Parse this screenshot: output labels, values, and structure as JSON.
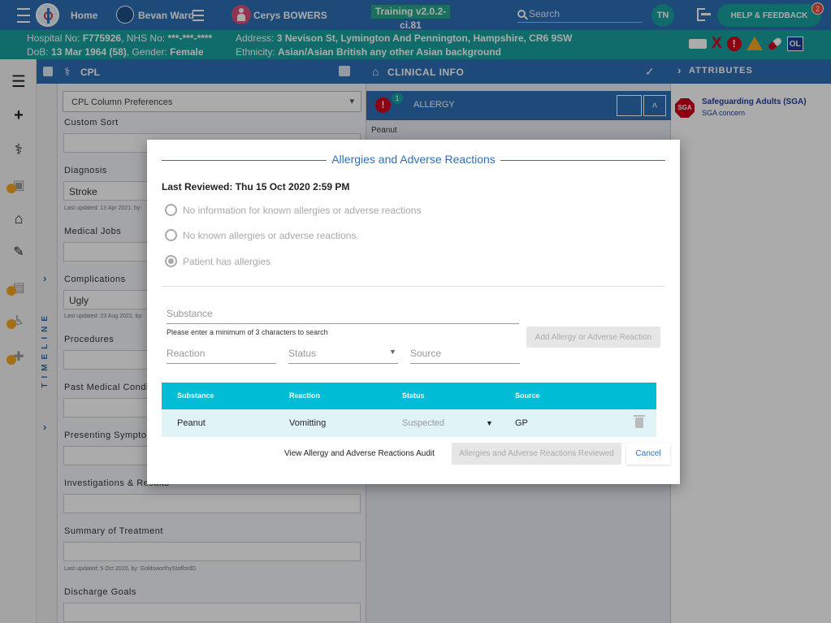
{
  "topbar": {
    "home_label": "Home",
    "ward_label": "Bevan Ward",
    "patient_name": "Cerys BOWERS",
    "training_label": "Training v2.0.2-ci.81",
    "search_placeholder": "Search",
    "user_initials": "TN",
    "help_label": "HELP & FEEDBACK",
    "notification_count": "2"
  },
  "patient": {
    "hospital_label": "Hospital No:",
    "hospital_no": "F775926",
    "nhs_label": ", NHS No:",
    "nhs_no": "***-***-****",
    "dob_label": "DoB:",
    "dob": "13 Mar 1964 (58)",
    "gender_label": ", Gender:",
    "gender": "Female",
    "address_label": "Address:",
    "address": "3 Nevison St, Lymington And Pennington, Hampshire, CR6 9SW",
    "ethnicity_label": "Ethnicity:",
    "ethnicity": "Asian/Asian British any other Asian background",
    "flag_x": "X",
    "flag_alert": "!",
    "flag_ol": "OL"
  },
  "panels": {
    "cpl_title": "CPL",
    "clinical_title": "CLINICAL INFO",
    "attributes_title": "ATTRIBUTES",
    "timeline_label": "TIMELINE"
  },
  "cpl": {
    "prefs_label": "CPL Column Preferences",
    "fields": [
      {
        "label": "Custom Sort",
        "value": "",
        "meta": ""
      },
      {
        "label": "Diagnosis",
        "value": "Stroke",
        "meta": "Last updated: 13 Apr 2021, by:"
      },
      {
        "label": "Medical Jobs",
        "value": "",
        "meta": ""
      },
      {
        "label": "Complications",
        "value": "Ugly",
        "meta": "Last updated: 23 Aug 2022, by:"
      },
      {
        "label": "Procedures",
        "value": "",
        "meta": ""
      },
      {
        "label": "Past Medical Conditi",
        "value": "",
        "meta": ""
      },
      {
        "label": "Presenting Symptom",
        "value": "",
        "meta": ""
      },
      {
        "label": "Investigations & Results",
        "value": "",
        "meta": ""
      },
      {
        "label": "Summary of Treatment",
        "value": "",
        "meta": "Last updated: 5 Oct 2020, by: GoldsworthyStaffordD"
      },
      {
        "label": "Discharge Goals",
        "value": "",
        "meta": ""
      }
    ]
  },
  "clinical": {
    "allergy_title": "ALLERGY",
    "allergy_count": "1",
    "allergy_item": "Peanut"
  },
  "attributes": {
    "sga_icon_text": "SGA",
    "sga_title": "Safeguarding Adults (SGA)",
    "sga_sub": "SGA concern"
  },
  "modal": {
    "title": "Allergies and Adverse Reactions",
    "last_reviewed": "Last Reviewed: Thu 15 Oct 2020 2:59 PM",
    "options": [
      {
        "label": "No information for known allergies or adverse reactions",
        "selected": false
      },
      {
        "label": "No known allergies or adverse reactions.",
        "selected": false
      },
      {
        "label": "Patient has allergies",
        "selected": true
      }
    ],
    "substance_placeholder": "Substance",
    "substance_hint": "Please enter a minimum of 3 characters to search",
    "add_button": "Add Allergy or Adverse Reaction",
    "reaction_placeholder": "Reaction",
    "status_placeholder": "Status",
    "source_placeholder": "Source",
    "table": {
      "headers": [
        "Substance",
        "Reaction",
        "Status",
        "Source"
      ],
      "rows": [
        {
          "substance": "Peanut",
          "reaction": "Vomitting",
          "status": "Suspected",
          "source": "GP"
        }
      ]
    },
    "audit_label": "View Allergy and Adverse Reactions Audit",
    "reviewed_button": "Allergies and Adverse Reactions Reviewed",
    "cancel_button": "Cancel"
  }
}
